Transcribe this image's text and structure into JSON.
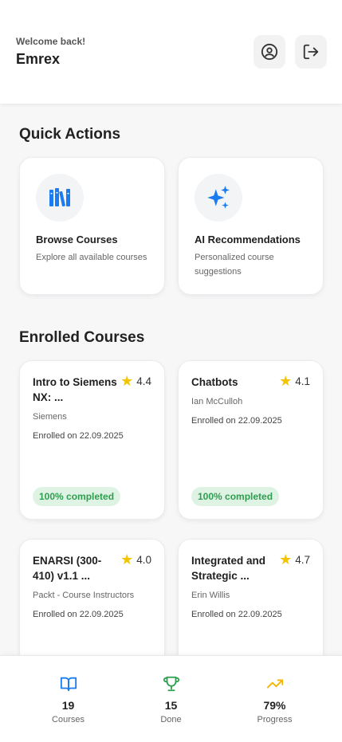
{
  "header": {
    "welcome": "Welcome back!",
    "username": "Emrex",
    "profile_icon": "user-circle-icon",
    "logout_icon": "logout-icon"
  },
  "quick_actions": {
    "title": "Quick Actions",
    "items": [
      {
        "title": "Browse Courses",
        "desc": "Explore all available courses",
        "icon": "books-icon",
        "icon_color": "#1a7cf0"
      },
      {
        "title": "AI Recommendations",
        "desc": "Personalized course suggestions",
        "icon": "sparkles-icon",
        "icon_color": "#1a7cf0"
      }
    ]
  },
  "enrolled": {
    "title": "Enrolled Courses",
    "courses": [
      {
        "title": "Intro to Siemens NX: ...",
        "rating": "4.4",
        "author": "Siemens",
        "enrolled": "Enrolled on 22.09.2025",
        "badge": "100% completed"
      },
      {
        "title": "Chatbots",
        "rating": "4.1",
        "author": "Ian McCulloh",
        "enrolled": "Enrolled on 22.09.2025",
        "badge": "100% completed"
      },
      {
        "title": "ENARSI (300-410) v1.1 ...",
        "rating": "4.0",
        "author": "Packt - Course Instructors",
        "enrolled": "Enrolled on 22.09.2025"
      },
      {
        "title": "Integrated and Strategic ...",
        "rating": "4.7",
        "author": "Erin Willis",
        "enrolled": "Enrolled on 22.09.2025"
      }
    ]
  },
  "stats": [
    {
      "value": "19",
      "label": "Courses",
      "icon": "book-open-icon",
      "color": "#1a7cf0"
    },
    {
      "value": "15",
      "label": "Done",
      "icon": "trophy-icon",
      "color": "#2e9e4f"
    },
    {
      "value": "79%",
      "label": "Progress",
      "icon": "trending-up-icon",
      "color": "#f5b400"
    }
  ],
  "colors": {
    "accent": "#1a7cf0",
    "success": "#2e9e4f",
    "star": "#f5c400"
  }
}
